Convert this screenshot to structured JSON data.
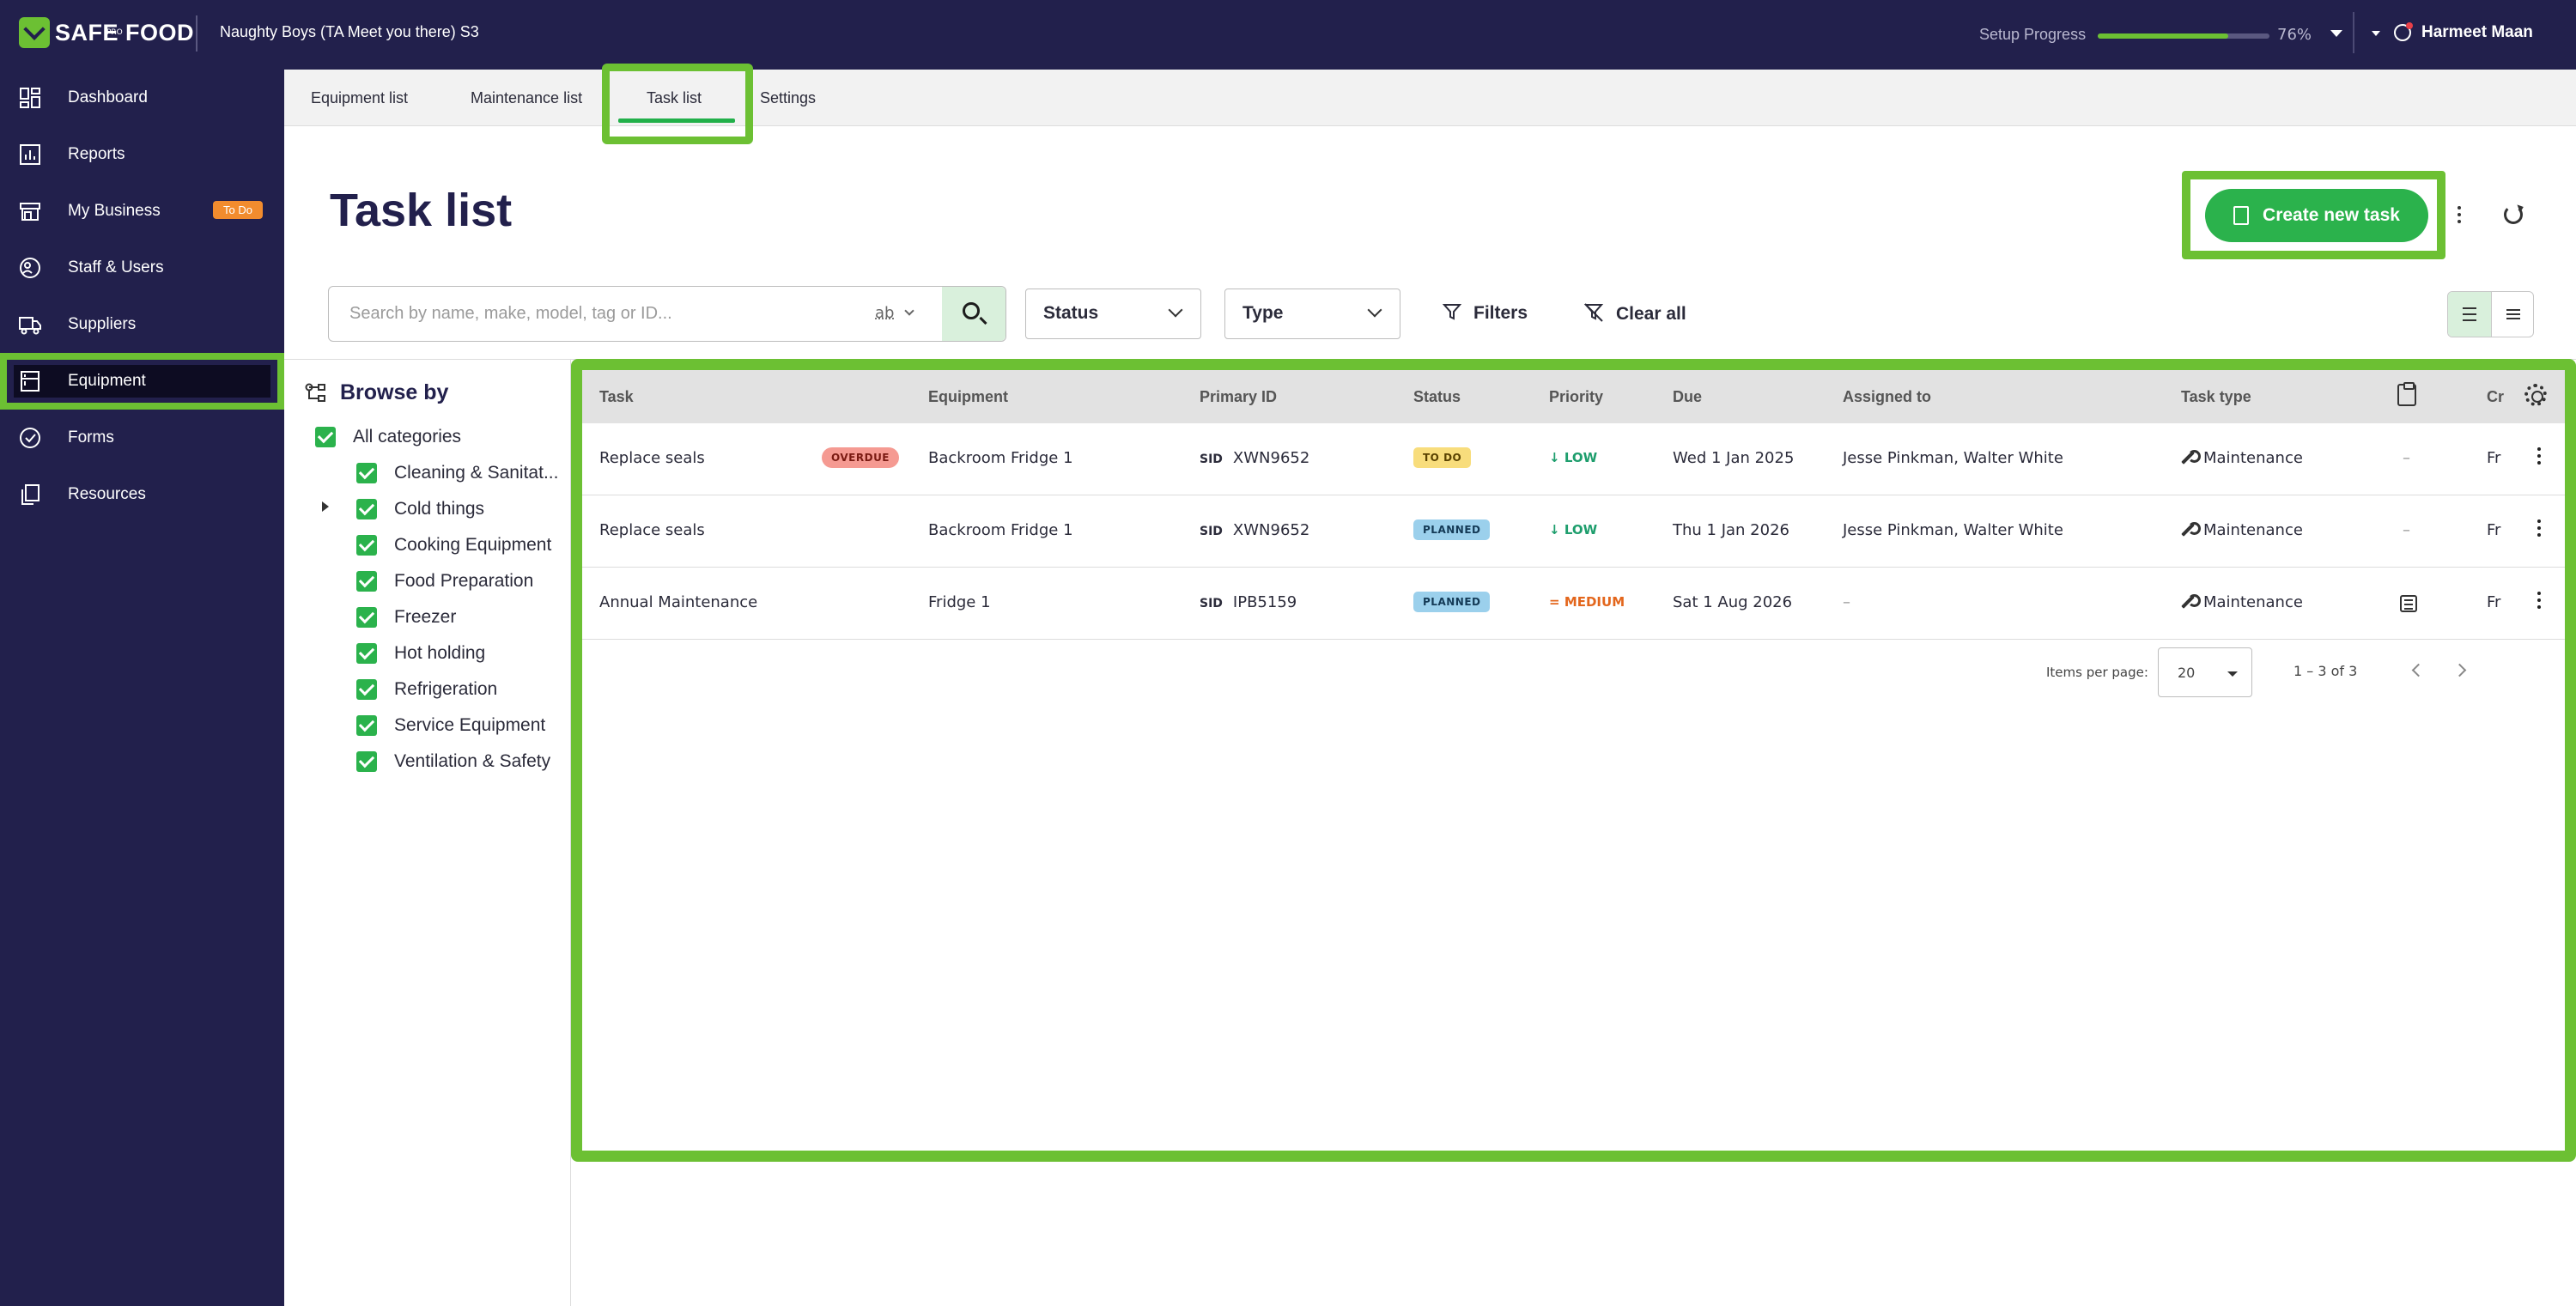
{
  "topbar": {
    "logo_text": "SAFE FOOD",
    "logo_sub": "PRO",
    "business_name": "Naughty Boys (TA Meet you there) S3",
    "setup_label": "Setup Progress",
    "setup_progress": 0.76,
    "setup_percent": "76%",
    "user_name": "Harmeet Maan"
  },
  "sidebar": {
    "items": [
      {
        "label": "Dashboard",
        "icon": "dashboard-icon"
      },
      {
        "label": "Reports",
        "icon": "reports-icon"
      },
      {
        "label": "My Business",
        "icon": "store-icon",
        "badge": "To Do"
      },
      {
        "label": "Staff & Users",
        "icon": "users-icon"
      },
      {
        "label": "Suppliers",
        "icon": "truck-icon"
      },
      {
        "label": "Equipment",
        "icon": "equipment-icon",
        "active": true
      },
      {
        "label": "Forms",
        "icon": "check-circle-icon"
      },
      {
        "label": "Resources",
        "icon": "copy-icon"
      }
    ]
  },
  "tabs": [
    {
      "label": "Equipment list"
    },
    {
      "label": "Maintenance list"
    },
    {
      "label": "Task list",
      "active": true
    },
    {
      "label": "Settings"
    }
  ],
  "page": {
    "title": "Task list",
    "create_button": "Create new task"
  },
  "filters": {
    "search_placeholder": "Search by name, make, model, tag or ID...",
    "ab_toggle": "ab",
    "status_label": "Status",
    "type_label": "Type",
    "filters_label": "Filters",
    "clear_label": "Clear all"
  },
  "browse": {
    "title": "Browse by",
    "all_label": "All categories",
    "categories": [
      "Cleaning & Sanitat...",
      "Cold things",
      "Cooking Equipment",
      "Food Preparation",
      "Freezer",
      "Hot holding",
      "Refrigeration",
      "Service Equipment",
      "Ventilation & Safety"
    ]
  },
  "table": {
    "columns": [
      "Task",
      "Equipment",
      "Primary ID",
      "Status",
      "Priority",
      "Due",
      "Assigned to",
      "Task type",
      "Cr"
    ],
    "rows": [
      {
        "task": "Replace seals",
        "flag": "OVERDUE",
        "equipment": "Backroom Fridge 1",
        "id_prefix": "SID",
        "id": "XWN9652",
        "status": "TO DO",
        "priority": "LOW",
        "due": "Wed 1 Jan 2025",
        "assigned": "Jesse Pinkman, Walter White",
        "type": "Maintenance",
        "form": "–",
        "created": "Fr"
      },
      {
        "task": "Replace seals",
        "flag": "",
        "equipment": "Backroom Fridge 1",
        "id_prefix": "SID",
        "id": "XWN9652",
        "status": "PLANNED",
        "priority": "LOW",
        "due": "Thu 1 Jan 2026",
        "assigned": "Jesse Pinkman, Walter White",
        "type": "Maintenance",
        "form": "–",
        "created": "Fr"
      },
      {
        "task": "Annual Maintenance",
        "flag": "",
        "equipment": "Fridge 1",
        "id_prefix": "SID",
        "id": "IPB5159",
        "status": "PLANNED",
        "priority": "MEDIUM",
        "due": "Sat 1 Aug 2026",
        "assigned": "–",
        "type": "Maintenance",
        "form": "",
        "created": "Fr"
      }
    ]
  },
  "pager": {
    "items_label": "Items per page:",
    "per_page": "20",
    "range": "1 – 3 of 3"
  },
  "colors": {
    "nav_bg": "#22204c",
    "accent_green": "#2bb24c",
    "highlight_green": "#6cc033",
    "overdue": "#f59a92",
    "todo": "#f8dd7c",
    "planned": "#9bd0ec"
  }
}
